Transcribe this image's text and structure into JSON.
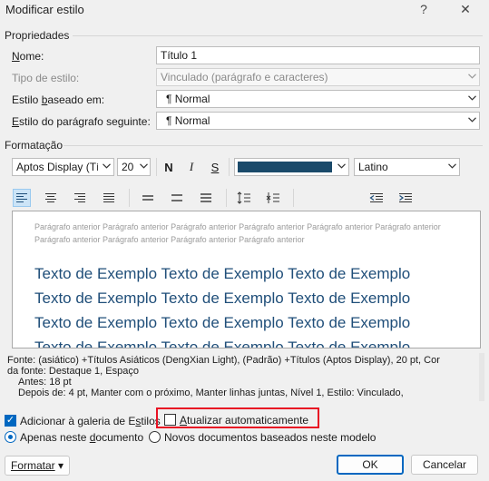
{
  "window": {
    "title": "Modificar estilo",
    "help_glyph": "?",
    "close_glyph": "✕"
  },
  "properties": {
    "section_label": "Propriedades",
    "name_label": "Nome:",
    "name_value": "Título 1",
    "type_label": "Tipo de estilo:",
    "type_value": "Vinculado (parágrafo e caracteres)",
    "based_on_label": "Estilo baseado em:",
    "based_on_value": "¶  Normal",
    "next_para_label": "Estilo do parágrafo seguinte:",
    "next_para_value": "¶  Normal"
  },
  "formatting": {
    "section_label": "Formatação",
    "font_name": "Aptos Display (Títu",
    "font_size": "20",
    "bold": "N",
    "italic": "I",
    "underline": "S",
    "font_color": "#1a4a6a",
    "script": "Latino"
  },
  "preview": {
    "prev_para_line1": "Parágrafo anterior Parágrafo anterior Parágrafo anterior Parágrafo anterior Parágrafo anterior Parágrafo anterior",
    "prev_para_line2": "Parágrafo anterior Parágrafo anterior Parágrafo anterior Parágrafo anterior",
    "sample_line": "Texto de Exemplo Texto de Exemplo Texto de Exemplo",
    "sample_color": "#1f4e79"
  },
  "description": {
    "line1": "Fonte: (asiático) +Títulos Asiáticos (DengXian Light), (Padrão) +Títulos (Aptos Display), 20 pt, Cor",
    "line2": "da fonte: Destaque 1, Espaço",
    "line3": "Antes:  18 pt",
    "line4": "Depois de:  4 pt, Manter com o próximo, Manter linhas juntas, Nível 1, Estilo: Vinculado,"
  },
  "options": {
    "add_to_gallery": "Adicionar à galeria de Estilos",
    "auto_update": "Atualizar automaticamente",
    "only_this_doc": "Apenas neste documento",
    "new_docs": "Novos documentos baseados neste modelo",
    "highlight_color": "#e81123"
  },
  "buttons": {
    "format": "Formatar",
    "format_arrow": "▾",
    "ok": "OK",
    "cancel": "Cancelar"
  }
}
